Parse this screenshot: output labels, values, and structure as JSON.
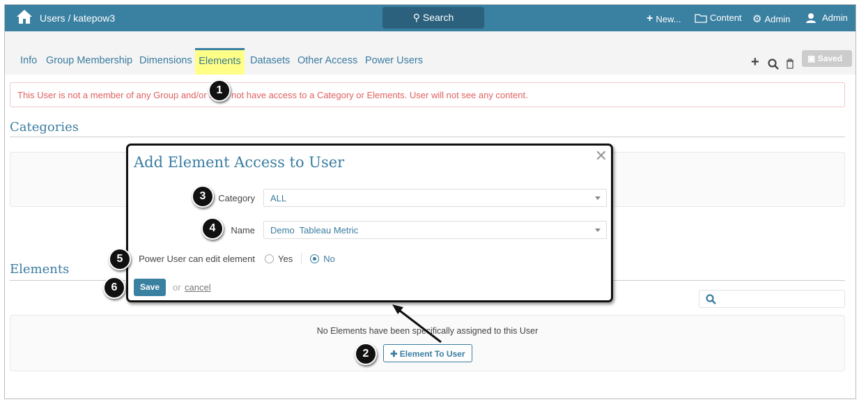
{
  "header": {
    "breadcrumb": "Users / katepow3",
    "search_label": "Search",
    "new_label": "New...",
    "content_label": "Content",
    "admin_label": "Admin",
    "user_label": "Admin"
  },
  "tabs": [
    {
      "label": "Info"
    },
    {
      "label": "Group Membership"
    },
    {
      "label": "Dimensions"
    },
    {
      "label": "Elements"
    },
    {
      "label": "Datasets"
    },
    {
      "label": "Other Access"
    },
    {
      "label": "Power Users"
    }
  ],
  "toolbar": {
    "saved_label": "Saved"
  },
  "alert": "This User is not a member of any Group and/or does not have access to a Category or Elements. User will not see any content.",
  "categories": {
    "heading": "Categories"
  },
  "elements": {
    "heading": "Elements",
    "empty_text": "No Elements have been specifically assigned to this User",
    "add_button": "Element To User"
  },
  "modal": {
    "title": "Add Element Access to User",
    "category_label": "Category",
    "category_value": "ALL",
    "name_label": "Name",
    "name_value": "Demo  Tableau Metric",
    "power_label": "Power User can edit element",
    "yes_label": "Yes",
    "no_label": "No",
    "selected": "No",
    "save_label": "Save",
    "or_label": "or",
    "cancel_label": "cancel"
  },
  "badges": [
    "1",
    "2",
    "3",
    "4",
    "5",
    "6"
  ]
}
